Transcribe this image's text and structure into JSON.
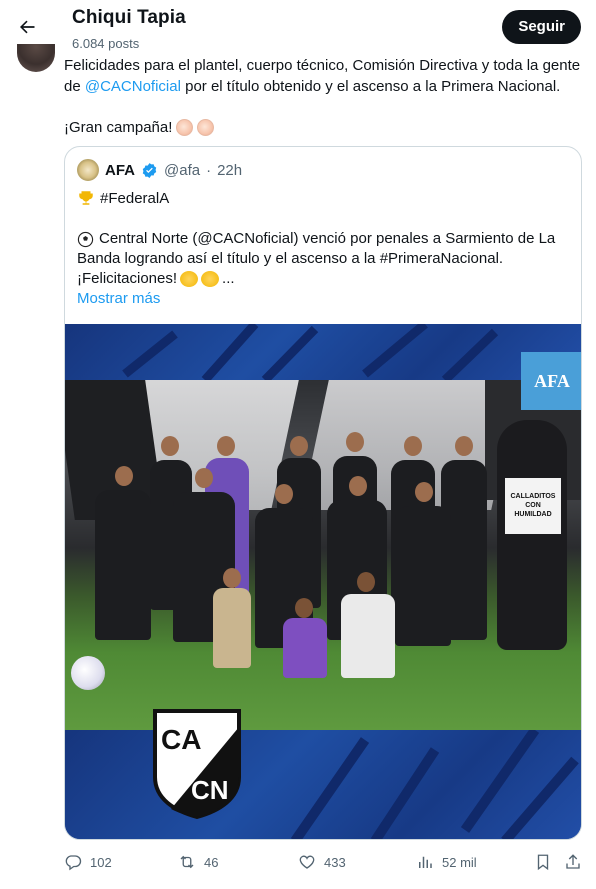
{
  "header": {
    "name": "Chiqui Tapia",
    "posts": "6.084 posts",
    "follow_label": "Seguir"
  },
  "tweet": {
    "text_1": "Felicidades para el plantel, cuerpo técnico, Comisión Directiva y toda la gente",
    "text_2a": "de ",
    "mention": "@CACNoficial",
    "text_2b": " por el título obtenido y el ascenso a la Primera Nacional.",
    "text_3": "¡Gran campaña!"
  },
  "quote": {
    "name": "AFA",
    "handle": "@afa",
    "dot": "·",
    "time": "22h",
    "tag": "#FederalA",
    "body_line1": "Central Norte (@CACNoficial) venció por penales a Sarmiento de La",
    "body_line2": "Banda logrando así el título y el ascenso a la #PrimeraNacional.",
    "body_line3": "¡Felicitaciones!",
    "body_ellipsis": "...",
    "show_more": "Mostrar más",
    "media": {
      "badge": "AFA",
      "shield_top": "CA",
      "shield_bottom": "CN",
      "mascot_sign_1": "CALLADITOS",
      "mascot_sign_2": "CON",
      "mascot_sign_3": "HUMILDAD"
    }
  },
  "actions": {
    "replies": "102",
    "reposts": "46",
    "likes": "433",
    "views": "52 mil"
  },
  "colors": {
    "accent": "#1d9bf0",
    "text": "#0f1419",
    "muted": "#536471",
    "border": "#cfd9de",
    "media_blue": "#1b3f8f"
  },
  "icons": [
    "back-arrow-icon",
    "verified-icon",
    "trophy-icon",
    "soccer-ball-icon",
    "clapping-hands-icon",
    "reply-icon",
    "repost-icon",
    "like-icon",
    "views-icon",
    "bookmark-icon",
    "share-icon"
  ]
}
